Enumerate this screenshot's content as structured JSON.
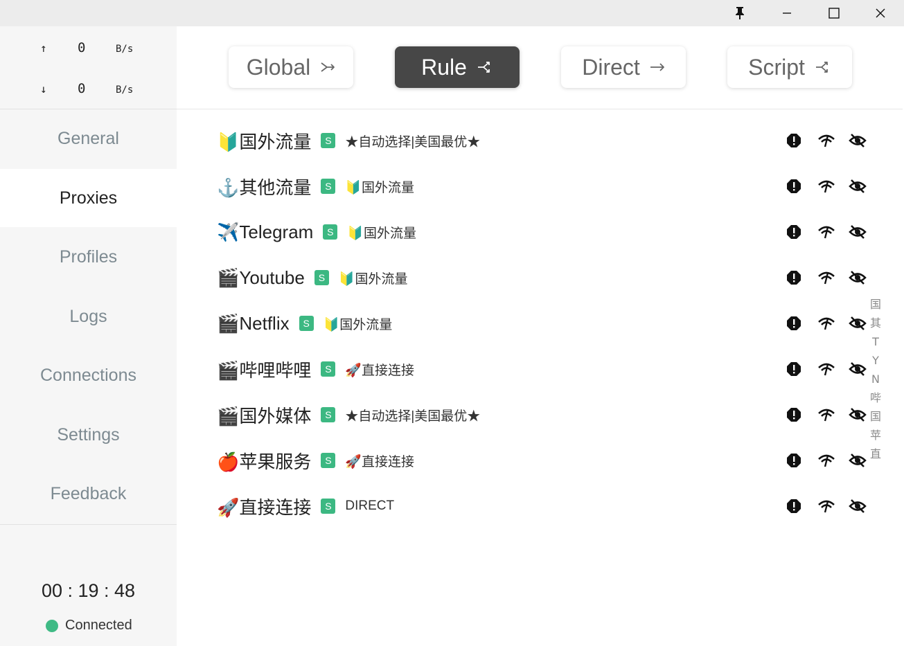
{
  "window": {
    "controls": [
      {
        "name": "pin-icon",
        "label": "pin"
      },
      {
        "name": "minimize-icon",
        "label": "minimize"
      },
      {
        "name": "maximize-icon",
        "label": "maximize"
      },
      {
        "name": "close-icon",
        "label": "close"
      }
    ]
  },
  "traffic": {
    "upload": {
      "arrow": "↑",
      "value": "0",
      "unit": "B/s"
    },
    "download": {
      "arrow": "↓",
      "value": "0",
      "unit": "B/s"
    }
  },
  "nav": {
    "items": [
      {
        "label": "General",
        "active": false
      },
      {
        "label": "Proxies",
        "active": true
      },
      {
        "label": "Profiles",
        "active": false
      },
      {
        "label": "Logs",
        "active": false
      },
      {
        "label": "Connections",
        "active": false
      },
      {
        "label": "Settings",
        "active": false
      },
      {
        "label": "Feedback",
        "active": false
      }
    ]
  },
  "footer": {
    "timer": "00 : 19 : 48",
    "status": "Connected",
    "status_color": "#3fba85"
  },
  "modes": [
    {
      "label": "Global",
      "icon": "merge-arrows-icon",
      "active": false
    },
    {
      "label": "Rule",
      "icon": "split-arrows-icon",
      "active": true
    },
    {
      "label": "Direct",
      "icon": "arrow-right-icon",
      "active": false
    },
    {
      "label": "Script",
      "icon": "split-arrows-icon",
      "active": false
    }
  ],
  "proxy_groups": [
    {
      "name": "🔰国外流量",
      "type": "S",
      "now": "★自动选择|美国最优★"
    },
    {
      "name": "⚓其他流量",
      "type": "S",
      "now": "🔰国外流量"
    },
    {
      "name": "✈️Telegram",
      "type": "S",
      "now": "🔰国外流量"
    },
    {
      "name": "🎬Youtube",
      "type": "S",
      "now": "🔰国外流量"
    },
    {
      "name": "🎬Netflix",
      "type": "S",
      "now": "🔰国外流量"
    },
    {
      "name": "🎬哔哩哔哩",
      "type": "S",
      "now": "🚀直接连接"
    },
    {
      "name": "🎬国外媒体",
      "type": "S",
      "now": "★自动选择|美国最优★"
    },
    {
      "name": "🍎苹果服务",
      "type": "S",
      "now": "🚀直接连接"
    },
    {
      "name": "🚀直接连接",
      "type": "S",
      "now": "DIRECT"
    }
  ],
  "row_actions": [
    "alert-icon",
    "latency-test-icon",
    "hide-icon"
  ],
  "index_letters": [
    "国",
    "其",
    "T",
    "Y",
    "N",
    "哔",
    "国",
    "苹",
    "直"
  ],
  "colors": {
    "accent_green": "#3cb882",
    "active_mode_bg": "#474747",
    "sidebar_bg": "#f6f6f6"
  }
}
